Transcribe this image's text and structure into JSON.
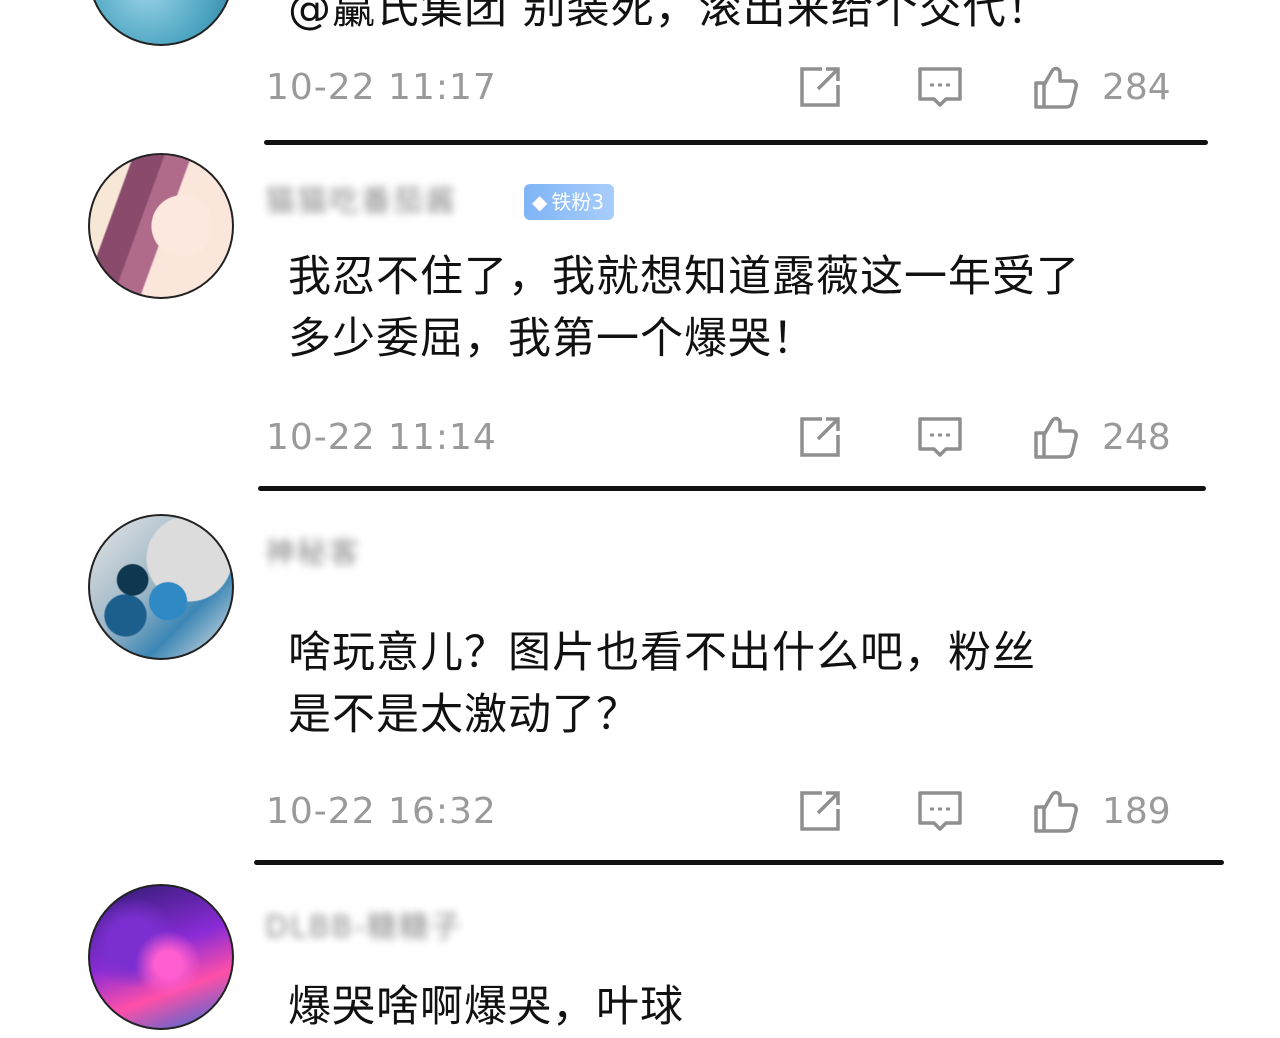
{
  "comments": [
    {
      "text": "@臝氏集团 别装死，滚出来给个交代！",
      "time": "10-22 11:17",
      "likes": "284"
    },
    {
      "username": "猫猫吃番茄酱",
      "badge": "铁粉3",
      "text_line1": "我忍不住了，我就想知道露薇这一年受了",
      "text_line2": "多少委屈，我第一个爆哭！",
      "time": "10-22 11:14",
      "likes": "248"
    },
    {
      "username": "神秘客",
      "text_line1": "啥玩意儿？图片也看不出什么吧，粉丝",
      "text_line2": "是不是太激动了？",
      "time": "10-22 16:32",
      "likes": "189"
    },
    {
      "username": "DLBB-糖糖子",
      "text": "爆哭啥啊爆哭，叶球"
    }
  ],
  "icons": {
    "share": "share-icon",
    "reply": "comment-icon",
    "like": "thumbs-up-icon",
    "badge": "diamond-icon"
  }
}
